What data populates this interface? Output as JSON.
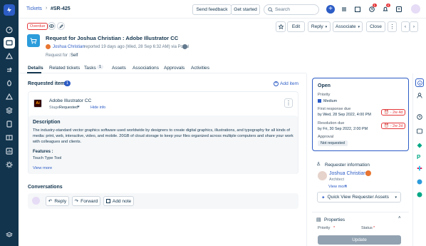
{
  "header": {
    "breadcrumb": "Tickets",
    "ticket_id": "#SR-425",
    "send_feedback": "Send feedback",
    "get_started": "Get started",
    "search_placeholder": "Search",
    "notif_count_1": "1",
    "notif_count_2": "4"
  },
  "toolbar": {
    "overdue": "Overdue",
    "edit": "Edit",
    "reply": "Reply",
    "associate": "Associate",
    "close": "Close"
  },
  "ticket": {
    "title": "Request for Joshua Christian : Adobe Illustrator CC",
    "requester_name": "Joshua Christian",
    "meta": "reported 19 days ago (Wed, 28 Sep 6:32 AM) via Portal",
    "request_for_label": "Request for :",
    "request_for_value": "Self"
  },
  "tabs": [
    {
      "label": "Details"
    },
    {
      "label": "Related tickets"
    },
    {
      "label": "Tasks",
      "count": "1"
    },
    {
      "label": "Assets"
    },
    {
      "label": "Associations"
    },
    {
      "label": "Approvals"
    },
    {
      "label": "Activities"
    }
  ],
  "requested_items": {
    "heading": "Requested items",
    "count": "1",
    "add_item": "Add item",
    "item_name": "Adobe Illustrator CC",
    "stage_label": "Stage:",
    "stage_value": "Requested",
    "hide_info": "Hide info",
    "desc_heading": "Description",
    "desc_text": "The industry-standard vector graphics software used worldwide by designers to create digital graphics, illustrations, and typography for all kinds of media: print, web, interactive, video, and mobile. 20GB of cloud storage to keep your files organized across multiple computers and share your work with colleagues and clients.",
    "features_heading": "Features :",
    "features_text": "Touch Type Tool",
    "view_more": "View more"
  },
  "conversations": {
    "heading": "Conversations",
    "reply": "Reply",
    "forward": "Forward",
    "add_note": "Add note"
  },
  "status_panel": {
    "status": "Open",
    "priority_label": "Priority",
    "priority_value": "Medium",
    "priority_color": "#2c5cc5",
    "frd_label": "First response due",
    "frd_value": "by Wed, 28 Sep 2022, 4:00 PM",
    "frd_sla": "- 2w 4d",
    "rd_label": "Resolution due",
    "rd_value": "by Fri, 30 Sep 2022, 2:00 PM",
    "rd_sla": "- 2w 2d",
    "approval_label": "Approval",
    "approval_value": "Not requested"
  },
  "requester_panel": {
    "heading": "Requester information",
    "name": "Joshua Christian",
    "role": "Architect",
    "view_more": "View more",
    "quick_view": "Quick View Requester Assets"
  },
  "properties_panel": {
    "heading": "Properties",
    "priority_label": "Priority",
    "status_label": "Status",
    "update": "Update"
  },
  "colors": {
    "rail": "#12344d",
    "accent": "#2c5cc5",
    "danger": "#e43538"
  }
}
